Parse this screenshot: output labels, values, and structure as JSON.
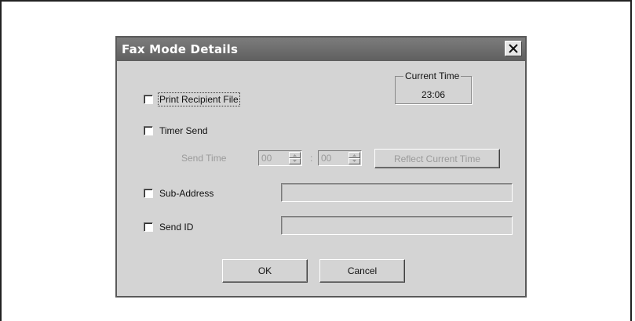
{
  "dialog": {
    "title": "Fax Mode Details",
    "close_label": "close"
  },
  "print_recipient_file": {
    "label": "Print Recipient File",
    "checked": false
  },
  "current_time": {
    "label": "Current Time",
    "value": "23:06"
  },
  "timer_send": {
    "label": "Timer Send",
    "checked": false
  },
  "send_time": {
    "label": "Send Time",
    "hour": "00",
    "minute": "00",
    "separator": ":",
    "reflect_button": "Reflect Current Time"
  },
  "sub_address": {
    "label": "Sub-Address",
    "checked": false,
    "value": ""
  },
  "send_id": {
    "label": "Send ID",
    "checked": false,
    "value": ""
  },
  "buttons": {
    "ok": "OK",
    "cancel": "Cancel"
  }
}
